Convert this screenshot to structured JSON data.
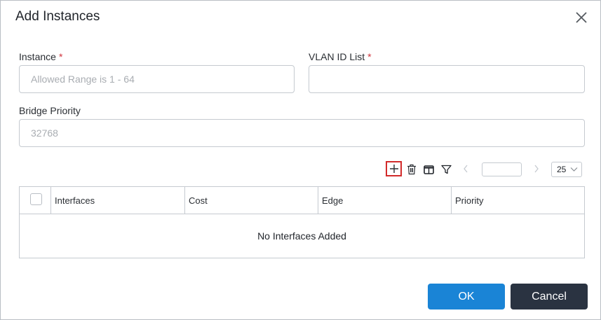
{
  "dialog": {
    "title": "Add Instances",
    "close_icon": "close-icon"
  },
  "form": {
    "instance": {
      "label": "Instance",
      "required_mark": "*",
      "placeholder": "Allowed Range is 1 - 64",
      "value": ""
    },
    "vlan_id_list": {
      "label": "VLAN ID List",
      "required_mark": "*",
      "placeholder": "",
      "value": ""
    },
    "bridge_priority": {
      "label": "Bridge Priority",
      "placeholder": "32768",
      "value": ""
    }
  },
  "toolbar": {
    "icons": [
      "plus-icon",
      "trash-icon",
      "columns-icon",
      "filter-icon",
      "chevron-left-icon",
      "chevron-right-icon"
    ],
    "page_number": "",
    "page_size": "25"
  },
  "table": {
    "columns": [
      "Interfaces",
      "Cost",
      "Edge",
      "Priority"
    ],
    "rows": [],
    "empty_message": "No Interfaces Added"
  },
  "footer": {
    "ok_label": "OK",
    "cancel_label": "Cancel"
  },
  "colors": {
    "primary": "#1a84d6",
    "secondary": "#2a3341",
    "required": "#d0343d",
    "highlight": "#d22b2b"
  }
}
